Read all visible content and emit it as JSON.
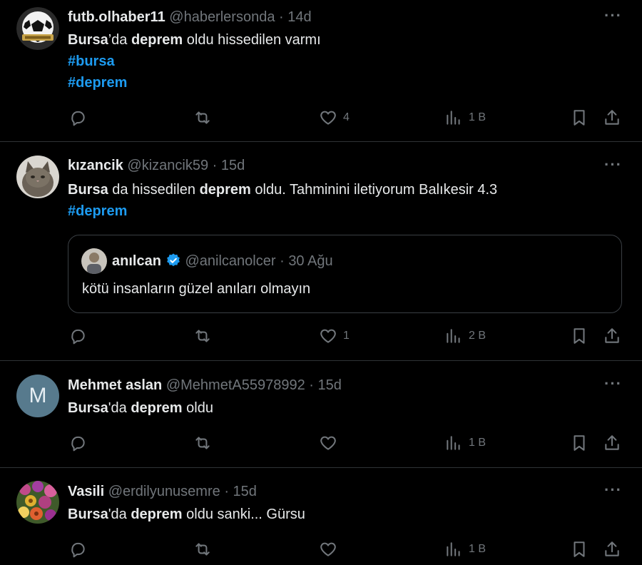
{
  "tweets": [
    {
      "name": "futb.olhaber11",
      "handle": "@haberlersonda",
      "sep": "·",
      "time": "14d",
      "lines": [
        [
          {
            "b": "Bursa"
          },
          {
            "t": "’da "
          },
          {
            "b": "deprem"
          },
          {
            "t": " oldu hissedilen varmı"
          }
        ],
        [
          {
            "h": "#bursa"
          }
        ],
        [
          {
            "h": "#deprem"
          }
        ]
      ],
      "reply_count": "",
      "retweet_count": "",
      "like_count": "4",
      "view_count": "1 B",
      "avatar": "soccer-ball"
    },
    {
      "name": "kızancik",
      "handle": "@kizancik59",
      "sep": "·",
      "time": "15d",
      "lines": [
        [
          {
            "b": "Bursa"
          },
          {
            "t": " da hissedilen "
          },
          {
            "b": "deprem"
          },
          {
            "t": " oldu. Tahminini iletiyorum Balıkesir 4.3"
          }
        ],
        [
          {
            "h": "#deprem"
          }
        ]
      ],
      "quote": {
        "name": "anılcan",
        "handle": "@anilcanolcer",
        "sep": "·",
        "time": "30 Ağu",
        "text": "kötü insanların güzel anıları olmayın"
      },
      "reply_count": "",
      "retweet_count": "",
      "like_count": "1",
      "view_count": "2 B",
      "avatar": "cat-photo"
    },
    {
      "name": "Mehmet aslan",
      "handle": "@MehmetA55978992",
      "sep": "·",
      "time": "15d",
      "avatar_letter": "M",
      "lines": [
        [
          {
            "b": "Bursa"
          },
          {
            "t": "'da "
          },
          {
            "b": "deprem"
          },
          {
            "t": " oldu"
          }
        ]
      ],
      "reply_count": "",
      "retweet_count": "",
      "like_count": "",
      "view_count": "1 B",
      "avatar": "letter"
    },
    {
      "name": "Vasili",
      "handle": "@erdilyunusemre",
      "sep": "·",
      "time": "15d",
      "lines": [
        [
          {
            "b": "Bursa"
          },
          {
            "t": "'da "
          },
          {
            "b": "deprem"
          },
          {
            "t": " oldu sanki... Gürsu"
          }
        ]
      ],
      "reply_count": "",
      "retweet_count": "",
      "like_count": "",
      "view_count": "1 B",
      "avatar": "flowers-photo"
    }
  ],
  "icons": {
    "reply": "reply-icon",
    "retweet": "retweet-icon",
    "like": "heart-icon",
    "views": "views-icon",
    "bookmark": "bookmark-icon",
    "share": "share-icon",
    "more": "more-icon"
  },
  "colors": {
    "background": "#000000",
    "text": "#e7e9ea",
    "muted": "#71767b",
    "hashtag": "#1d9bf0",
    "border": "#2f3336"
  }
}
